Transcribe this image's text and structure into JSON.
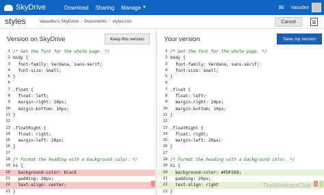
{
  "topbar": {
    "brand": "SkyDrive",
    "nav": [
      "Download",
      "Sharing",
      "Manage"
    ],
    "user": "Vasudev"
  },
  "header": {
    "title": "styles",
    "breadcrumb": [
      "Vasudev's SkyDrive",
      "Documents",
      "styles.css"
    ],
    "cancel": "Cancel"
  },
  "left_pane": {
    "title": "Version on SkyDrive",
    "button": "Keep this version"
  },
  "right_pane": {
    "title": "Your version",
    "button": "Save my version"
  },
  "code_left": [
    {
      "n": "1",
      "t": "/* Set the font for the whole page. */",
      "k": "comment"
    },
    {
      "n": "2",
      "t": "body {",
      "k": "plain"
    },
    {
      "n": "3",
      "t": "  font-family: Verdana, sans-serif;",
      "k": "plain"
    },
    {
      "n": "4",
      "t": "  font-size: small;",
      "k": "plain"
    },
    {
      "n": "5",
      "t": "}",
      "k": "plain"
    },
    {
      "n": "6",
      "t": "",
      "k": "plain"
    },
    {
      "n": "7",
      "t": ".float {",
      "k": "plain"
    },
    {
      "n": "8",
      "t": "  float: left;",
      "k": "plain"
    },
    {
      "n": "9",
      "t": "  margin-right: 20px;",
      "k": "plain"
    },
    {
      "n": "10",
      "t": "  margin-bottom: 10px;",
      "k": "plain"
    },
    {
      "n": "11",
      "t": "}",
      "k": "plain"
    },
    {
      "n": "12",
      "t": "",
      "k": "plain"
    },
    {
      "n": "13",
      "t": ".floatRight {",
      "k": "plain"
    },
    {
      "n": "14",
      "t": "  float: right;",
      "k": "plain"
    },
    {
      "n": "15",
      "t": "  margin-left: 20px;",
      "k": "plain"
    },
    {
      "n": "16",
      "t": "}",
      "k": "plain"
    },
    {
      "n": "17",
      "t": "",
      "k": "plain"
    },
    {
      "n": "18",
      "t": "/* Format the heading with a background color. */",
      "k": "comment"
    },
    {
      "n": "19",
      "t": "h1 {",
      "k": "plain"
    },
    {
      "n": "20",
      "t": "  background-color: black",
      "k": "del"
    },
    {
      "n": "21",
      "t": "  padding: 20px;",
      "k": "plain"
    },
    {
      "n": "22",
      "t": "  text-align: center;",
      "k": "del"
    },
    {
      "n": "23",
      "t": "}",
      "k": "plain"
    }
  ],
  "code_right": [
    {
      "n": "1",
      "t": "/* Set the font for the whole page. */",
      "k": "comment"
    },
    {
      "n": "2",
      "t": "body {",
      "k": "plain"
    },
    {
      "n": "3",
      "t": "  font-family: Verdana, sans-serif;",
      "k": "plain"
    },
    {
      "n": "4",
      "t": "  font-size: small;",
      "k": "plain"
    },
    {
      "n": "5",
      "t": "}",
      "k": "plain"
    },
    {
      "n": "6",
      "t": "",
      "k": "plain"
    },
    {
      "n": "7",
      "t": ".float {",
      "k": "plain"
    },
    {
      "n": "8",
      "t": "  float: left;",
      "k": "plain"
    },
    {
      "n": "9",
      "t": "  margin-right: 20px;",
      "k": "plain"
    },
    {
      "n": "10",
      "t": "  margin-bottom: 10px;",
      "k": "plain"
    },
    {
      "n": "11",
      "t": "}",
      "k": "plain"
    },
    {
      "n": "12",
      "t": "",
      "k": "plain"
    },
    {
      "n": "13",
      "t": ".floatRight {",
      "k": "plain"
    },
    {
      "n": "14",
      "t": "  float: right;",
      "k": "plain"
    },
    {
      "n": "15",
      "t": "  margin-left: 20px;",
      "k": "plain"
    },
    {
      "n": "16",
      "t": "}",
      "k": "plain"
    },
    {
      "n": "17",
      "t": "",
      "k": "plain"
    },
    {
      "n": "18",
      "t": "/* Format the heading with a background color. */",
      "k": "comment"
    },
    {
      "n": "19",
      "t": "h1 {",
      "k": "plain"
    },
    {
      "n": "20",
      "t": "  background-color: #FDF5E6;",
      "k": "add"
    },
    {
      "n": "21",
      "t": "  padding: 20px;",
      "k": "plain"
    },
    {
      "n": "22",
      "t": "  text-align: right",
      "k": "add"
    },
    {
      "n": "23",
      "t": "}",
      "k": "plain"
    }
  ],
  "colors": {
    "brand_blue": "#0f64c0",
    "deleted_line": "#f7c6c6",
    "added_line": "#e6f0d2",
    "comment_text": "#1f7a1f"
  },
  "watermark": "TheWindowsClub"
}
